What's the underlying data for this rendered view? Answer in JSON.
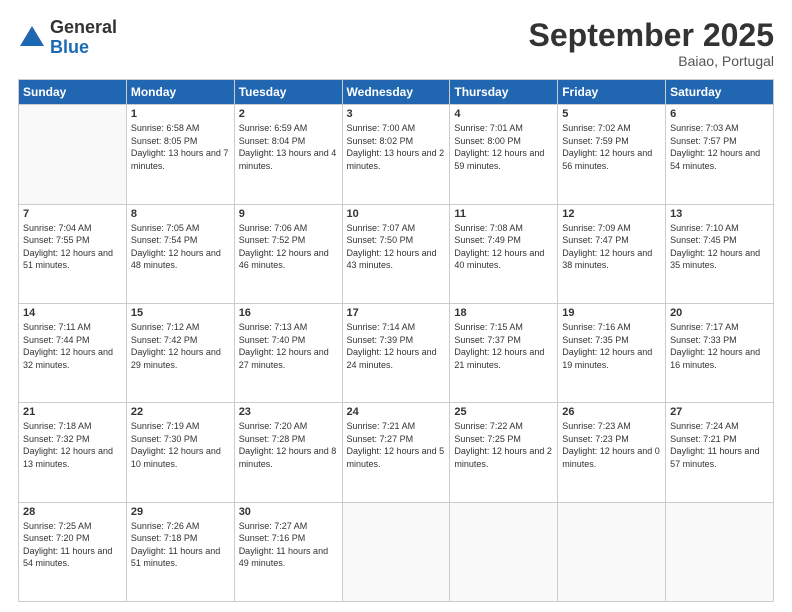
{
  "logo": {
    "general": "General",
    "blue": "Blue"
  },
  "header": {
    "month": "September 2025",
    "location": "Baiao, Portugal"
  },
  "weekdays": [
    "Sunday",
    "Monday",
    "Tuesday",
    "Wednesday",
    "Thursday",
    "Friday",
    "Saturday"
  ],
  "weeks": [
    [
      {
        "day": "",
        "sunrise": "",
        "sunset": "",
        "daylight": ""
      },
      {
        "day": "1",
        "sunrise": "Sunrise: 6:58 AM",
        "sunset": "Sunset: 8:05 PM",
        "daylight": "Daylight: 13 hours and 7 minutes."
      },
      {
        "day": "2",
        "sunrise": "Sunrise: 6:59 AM",
        "sunset": "Sunset: 8:04 PM",
        "daylight": "Daylight: 13 hours and 4 minutes."
      },
      {
        "day": "3",
        "sunrise": "Sunrise: 7:00 AM",
        "sunset": "Sunset: 8:02 PM",
        "daylight": "Daylight: 13 hours and 2 minutes."
      },
      {
        "day": "4",
        "sunrise": "Sunrise: 7:01 AM",
        "sunset": "Sunset: 8:00 PM",
        "daylight": "Daylight: 12 hours and 59 minutes."
      },
      {
        "day": "5",
        "sunrise": "Sunrise: 7:02 AM",
        "sunset": "Sunset: 7:59 PM",
        "daylight": "Daylight: 12 hours and 56 minutes."
      },
      {
        "day": "6",
        "sunrise": "Sunrise: 7:03 AM",
        "sunset": "Sunset: 7:57 PM",
        "daylight": "Daylight: 12 hours and 54 minutes."
      }
    ],
    [
      {
        "day": "7",
        "sunrise": "Sunrise: 7:04 AM",
        "sunset": "Sunset: 7:55 PM",
        "daylight": "Daylight: 12 hours and 51 minutes."
      },
      {
        "day": "8",
        "sunrise": "Sunrise: 7:05 AM",
        "sunset": "Sunset: 7:54 PM",
        "daylight": "Daylight: 12 hours and 48 minutes."
      },
      {
        "day": "9",
        "sunrise": "Sunrise: 7:06 AM",
        "sunset": "Sunset: 7:52 PM",
        "daylight": "Daylight: 12 hours and 46 minutes."
      },
      {
        "day": "10",
        "sunrise": "Sunrise: 7:07 AM",
        "sunset": "Sunset: 7:50 PM",
        "daylight": "Daylight: 12 hours and 43 minutes."
      },
      {
        "day": "11",
        "sunrise": "Sunrise: 7:08 AM",
        "sunset": "Sunset: 7:49 PM",
        "daylight": "Daylight: 12 hours and 40 minutes."
      },
      {
        "day": "12",
        "sunrise": "Sunrise: 7:09 AM",
        "sunset": "Sunset: 7:47 PM",
        "daylight": "Daylight: 12 hours and 38 minutes."
      },
      {
        "day": "13",
        "sunrise": "Sunrise: 7:10 AM",
        "sunset": "Sunset: 7:45 PM",
        "daylight": "Daylight: 12 hours and 35 minutes."
      }
    ],
    [
      {
        "day": "14",
        "sunrise": "Sunrise: 7:11 AM",
        "sunset": "Sunset: 7:44 PM",
        "daylight": "Daylight: 12 hours and 32 minutes."
      },
      {
        "day": "15",
        "sunrise": "Sunrise: 7:12 AM",
        "sunset": "Sunset: 7:42 PM",
        "daylight": "Daylight: 12 hours and 29 minutes."
      },
      {
        "day": "16",
        "sunrise": "Sunrise: 7:13 AM",
        "sunset": "Sunset: 7:40 PM",
        "daylight": "Daylight: 12 hours and 27 minutes."
      },
      {
        "day": "17",
        "sunrise": "Sunrise: 7:14 AM",
        "sunset": "Sunset: 7:39 PM",
        "daylight": "Daylight: 12 hours and 24 minutes."
      },
      {
        "day": "18",
        "sunrise": "Sunrise: 7:15 AM",
        "sunset": "Sunset: 7:37 PM",
        "daylight": "Daylight: 12 hours and 21 minutes."
      },
      {
        "day": "19",
        "sunrise": "Sunrise: 7:16 AM",
        "sunset": "Sunset: 7:35 PM",
        "daylight": "Daylight: 12 hours and 19 minutes."
      },
      {
        "day": "20",
        "sunrise": "Sunrise: 7:17 AM",
        "sunset": "Sunset: 7:33 PM",
        "daylight": "Daylight: 12 hours and 16 minutes."
      }
    ],
    [
      {
        "day": "21",
        "sunrise": "Sunrise: 7:18 AM",
        "sunset": "Sunset: 7:32 PM",
        "daylight": "Daylight: 12 hours and 13 minutes."
      },
      {
        "day": "22",
        "sunrise": "Sunrise: 7:19 AM",
        "sunset": "Sunset: 7:30 PM",
        "daylight": "Daylight: 12 hours and 10 minutes."
      },
      {
        "day": "23",
        "sunrise": "Sunrise: 7:20 AM",
        "sunset": "Sunset: 7:28 PM",
        "daylight": "Daylight: 12 hours and 8 minutes."
      },
      {
        "day": "24",
        "sunrise": "Sunrise: 7:21 AM",
        "sunset": "Sunset: 7:27 PM",
        "daylight": "Daylight: 12 hours and 5 minutes."
      },
      {
        "day": "25",
        "sunrise": "Sunrise: 7:22 AM",
        "sunset": "Sunset: 7:25 PM",
        "daylight": "Daylight: 12 hours and 2 minutes."
      },
      {
        "day": "26",
        "sunrise": "Sunrise: 7:23 AM",
        "sunset": "Sunset: 7:23 PM",
        "daylight": "Daylight: 12 hours and 0 minutes."
      },
      {
        "day": "27",
        "sunrise": "Sunrise: 7:24 AM",
        "sunset": "Sunset: 7:21 PM",
        "daylight": "Daylight: 11 hours and 57 minutes."
      }
    ],
    [
      {
        "day": "28",
        "sunrise": "Sunrise: 7:25 AM",
        "sunset": "Sunset: 7:20 PM",
        "daylight": "Daylight: 11 hours and 54 minutes."
      },
      {
        "day": "29",
        "sunrise": "Sunrise: 7:26 AM",
        "sunset": "Sunset: 7:18 PM",
        "daylight": "Daylight: 11 hours and 51 minutes."
      },
      {
        "day": "30",
        "sunrise": "Sunrise: 7:27 AM",
        "sunset": "Sunset: 7:16 PM",
        "daylight": "Daylight: 11 hours and 49 minutes."
      },
      {
        "day": "",
        "sunrise": "",
        "sunset": "",
        "daylight": ""
      },
      {
        "day": "",
        "sunrise": "",
        "sunset": "",
        "daylight": ""
      },
      {
        "day": "",
        "sunrise": "",
        "sunset": "",
        "daylight": ""
      },
      {
        "day": "",
        "sunrise": "",
        "sunset": "",
        "daylight": ""
      }
    ]
  ]
}
